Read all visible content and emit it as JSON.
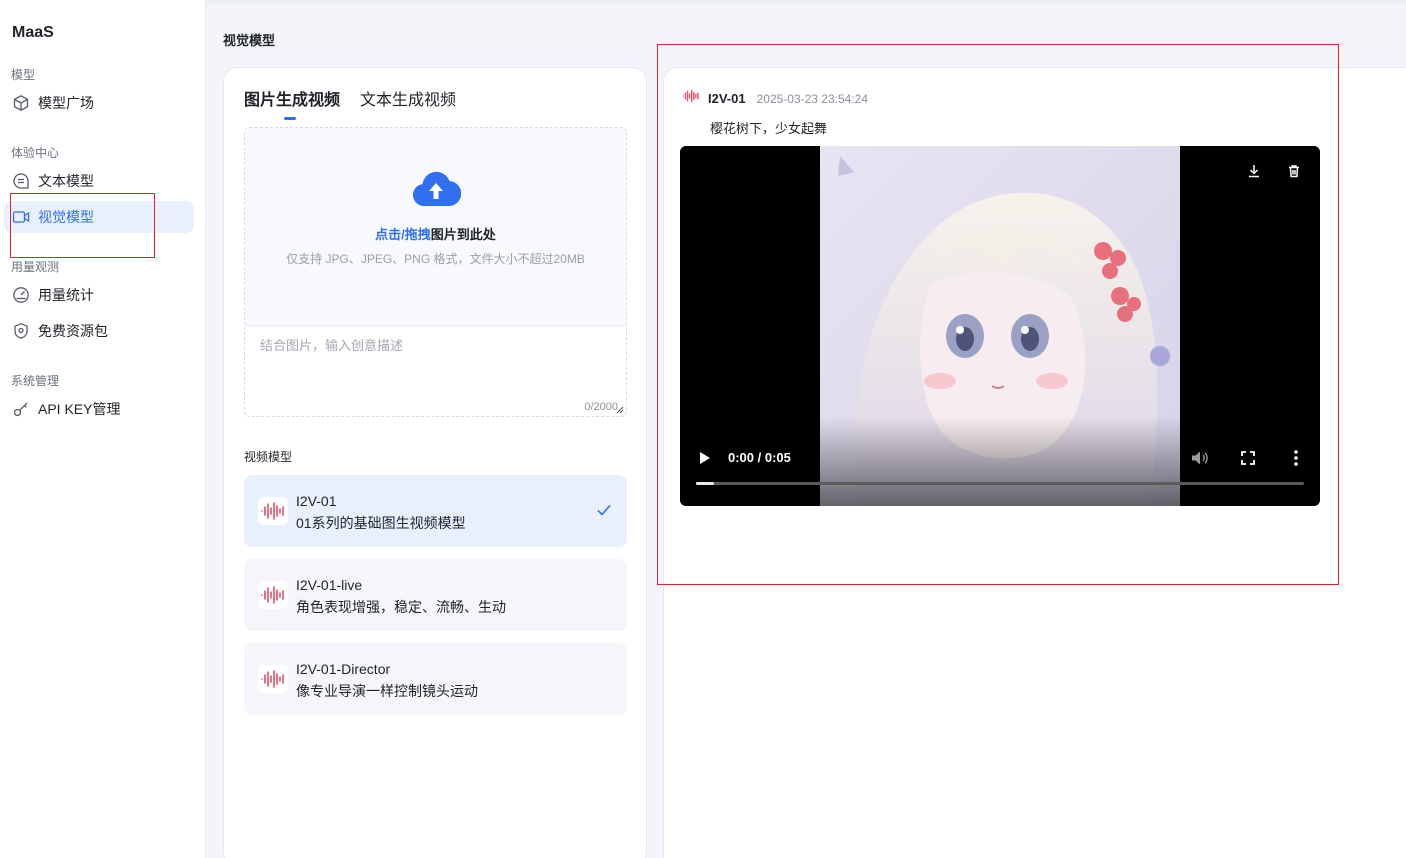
{
  "app": {
    "title": "MaaS"
  },
  "sidebar": {
    "groups": [
      {
        "title": "模型",
        "items": [
          {
            "label": "模型广场",
            "icon": "cube-icon"
          }
        ]
      },
      {
        "title": "体验中心",
        "items": [
          {
            "label": "文本模型",
            "icon": "chat-bubble-icon"
          },
          {
            "label": "视觉模型",
            "icon": "video-camera-icon",
            "active": true
          }
        ]
      },
      {
        "title": "用量观测",
        "items": [
          {
            "label": "用量统计",
            "icon": "gauge-icon"
          },
          {
            "label": "免费资源包",
            "icon": "shield-icon"
          }
        ]
      },
      {
        "title": "系统管理",
        "items": [
          {
            "label": "API KEY管理",
            "icon": "key-icon"
          }
        ]
      }
    ]
  },
  "page": {
    "title": "视觉模型"
  },
  "tabs": [
    {
      "label": "图片生成视频",
      "active": true
    },
    {
      "label": "文本生成视频"
    }
  ],
  "upload": {
    "link_text": "点击/拖拽",
    "main_text": "图片到此处",
    "hint": "仅支持 JPG、JPEG、PNG 格式，文件大小不超过20MB",
    "prompt_placeholder": "结合图片，输入创意描述",
    "counter": "0/2000"
  },
  "models": {
    "label": "视频模型",
    "items": [
      {
        "name": "I2V-01",
        "desc": "01系列的基础图生视频模型",
        "selected": true
      },
      {
        "name": "I2V-01-live",
        "desc": "角色表现增强，稳定、流畅、生动"
      },
      {
        "name": "I2V-01-Director",
        "desc": "像专业导演一样控制镜头运动"
      }
    ]
  },
  "result": {
    "model": "I2V-01",
    "timestamp": "2025-03-23 23:54:24",
    "prompt": "樱花树下，少女起舞",
    "video": {
      "time": "0:00 / 0:05",
      "progress": 0.03
    }
  },
  "colors": {
    "accent": "#2f6ff0",
    "annotation": "#d9252b",
    "model_icon": "#e0506a"
  }
}
